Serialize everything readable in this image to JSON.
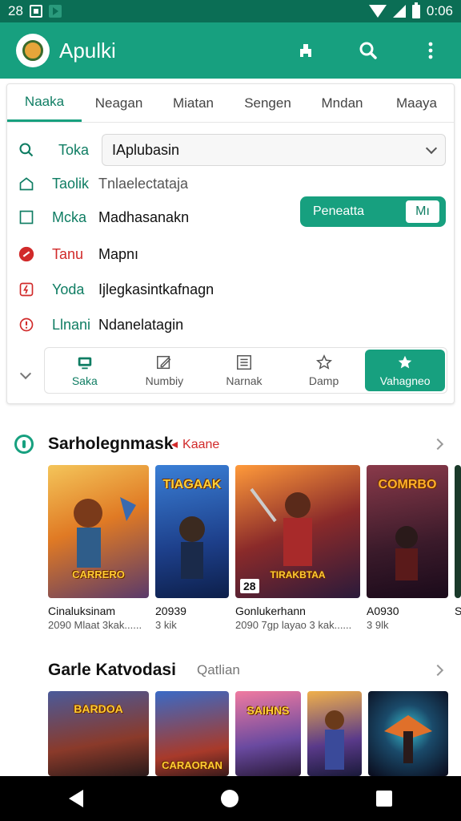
{
  "status_bar": {
    "time_left": "28",
    "time_right": "0:06"
  },
  "app_bar": {
    "title": "Apulki"
  },
  "tabs": [
    "Naaka",
    "Neagan",
    "Miatan",
    "Sengen",
    "Mndan",
    "Maaya"
  ],
  "form": {
    "select_label": "Toka",
    "select_value": "IAplubasin",
    "row2_label": "Taolik",
    "row2_value": "Tnlaelectataja",
    "row3_label": "Mcka",
    "row3_value": "Madhasanakn",
    "toggle_on": "Peneatta",
    "toggle_off": "Mı",
    "row4_label": "Tanu",
    "row4_value": "Mapnı",
    "row5_label": "Yoda",
    "row5_value": "Ijlegkasintkafnagn",
    "row6_label": "Llnani",
    "row6_value": "Ndanelatagin"
  },
  "bottom_nav": [
    {
      "label": "Saka",
      "icon": "tablet-icon"
    },
    {
      "label": "Numbiy",
      "icon": "edit-icon"
    },
    {
      "label": "Narnak",
      "icon": "list-icon"
    },
    {
      "label": "Damp",
      "icon": "star-outline-icon"
    },
    {
      "label": "Vahagneo",
      "icon": "star-icon"
    }
  ],
  "section1": {
    "title": "Sarholegnmask",
    "tag": "Kaane",
    "games": [
      {
        "art": "CARRERO",
        "name": "Cinaluksinam",
        "meta": "2090 Mlaat 3kak......"
      },
      {
        "art": "TIAGAAK",
        "name": "20939",
        "meta": "3 kik"
      },
      {
        "art": "TIRAKBTAA",
        "badge": "28",
        "name": "Gonlukerhann",
        "meta": "2090 7gp layao 3 kak......"
      },
      {
        "art": "COMRBO",
        "name": "A0930",
        "meta": "3 9lk"
      },
      {
        "art": "",
        "name": "S",
        "meta": ""
      }
    ]
  },
  "section2": {
    "title": "Garle Katvodasi",
    "subtitle": "Qatlian",
    "games": [
      {
        "art": "BARDOA"
      },
      {
        "art": "CARAORAN"
      },
      {
        "art": "SAIHNS"
      },
      {
        "art": ""
      },
      {
        "art": ""
      }
    ]
  },
  "colors": {
    "primary": "#17a07f",
    "primary_dark": "#0b6e55",
    "accent_red": "#d12a2a"
  }
}
